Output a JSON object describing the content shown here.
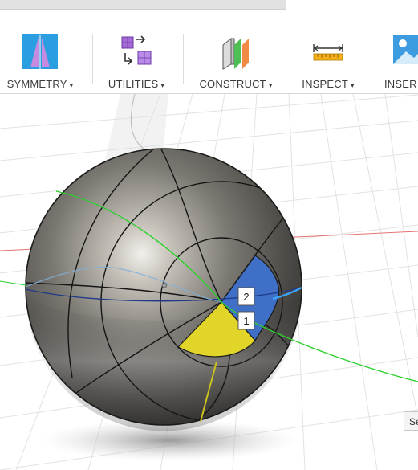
{
  "toolbar": {
    "tools": [
      {
        "label": "SYMMETRY",
        "icon": "symmetry-icon"
      },
      {
        "label": "UTILITIES",
        "icon": "utilities-icon"
      },
      {
        "label": "CONSTRUCT",
        "icon": "construct-icon"
      },
      {
        "label": "INSPECT",
        "icon": "inspect-icon"
      },
      {
        "label": "INSER",
        "icon": "insert-image-icon"
      }
    ],
    "caret": "▾"
  },
  "viewport": {
    "markers": [
      "2",
      "1"
    ],
    "side_tab_label": "Se"
  },
  "colors": {
    "sphere": "#7a7772",
    "blue_face": "#3f6fc6",
    "yellow_face": "#e1d52a",
    "green_axis": "#2ed02e",
    "red_axis": "#e25555",
    "accent_blue": "#1e86c8"
  }
}
